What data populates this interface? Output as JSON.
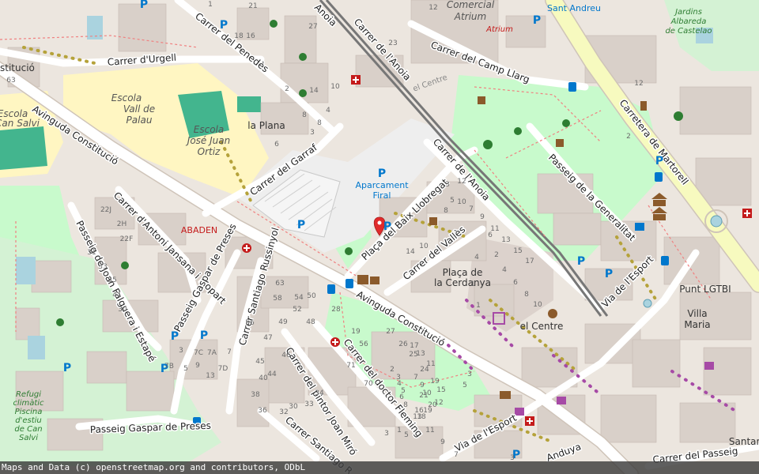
{
  "colors": {
    "background": "#ece6df",
    "building": "#d9d0c9",
    "park": "#c8facc",
    "school": "#fff6c2",
    "pitch": "#43b58e",
    "parking_area": "#eeeeee",
    "primary_road": "#f7fabf",
    "road": "#ffffff",
    "railway": "#777777",
    "marker": "#e02b2b",
    "parking_text": "#0077cc"
  },
  "streets": [
    {
      "text": "Carrer d'Urgell"
    },
    {
      "text": "Carrer del Penedès"
    },
    {
      "text": "Avinguda Constitució"
    },
    {
      "text": "Carrer del Garraf"
    },
    {
      "text": "Carrer d'Antoni Jansana i Llopart"
    },
    {
      "text": "Passeig de Joan Falguera i Estapé"
    },
    {
      "text": "Passeig Gaspar de Preses"
    },
    {
      "text": "Carrer Santiago Russinyol"
    },
    {
      "text": "Avinguda Constitució"
    },
    {
      "text": "Carrer del pintor Joan Miró"
    },
    {
      "text": "Carrer del doctor Fleming"
    },
    {
      "text": "Carrer Santiago R"
    },
    {
      "text": "Passeig Gaspar de Preses"
    },
    {
      "text": "Plaça del Baix Llobregat"
    },
    {
      "text": "Carrer del Vallès"
    },
    {
      "text": "Carrer de l'Anoia"
    },
    {
      "text": "Carrer de l'Anoia"
    },
    {
      "text": "Carrer del Camp Llarg"
    },
    {
      "text": "Carretera de Martorell"
    },
    {
      "text": "Passeig de la Generalitat"
    },
    {
      "text": "Via de l'Esport"
    },
    {
      "text": "Via de l'Esport"
    },
    {
      "text": "Carrer del Passeig"
    },
    {
      "text": "Anoia"
    },
    {
      "text": "Anduya"
    }
  ],
  "areas": [
    {
      "text": "Escola"
    },
    {
      "text": "Vall de"
    },
    {
      "text": "Palau"
    },
    {
      "text": "Escola"
    },
    {
      "text": "José Juan"
    },
    {
      "text": "Ortiz"
    },
    {
      "text": "Escola"
    },
    {
      "text": "Can Salvi"
    },
    {
      "text": "Aparcament"
    },
    {
      "text": "Firal"
    },
    {
      "text": "Comercial"
    },
    {
      "text": "Atrium"
    },
    {
      "text": "Jardins"
    },
    {
      "text": "Albareda"
    },
    {
      "text": "de Castelao"
    },
    {
      "text": "Refugi"
    },
    {
      "text": "climàtic"
    },
    {
      "text": "Piscina"
    },
    {
      "text": "d'estiu"
    },
    {
      "text": "de Can"
    },
    {
      "text": "Salvi"
    }
  ],
  "places": [
    {
      "text": "la Plana"
    },
    {
      "text": "el Centre"
    },
    {
      "text": "el Centre"
    },
    {
      "text": "Plaça de"
    },
    {
      "text": "la Cerdanya"
    },
    {
      "text": "Punt LGTBI"
    },
    {
      "text": "Villa"
    },
    {
      "text": "Maria"
    },
    {
      "text": "Sant Andreu"
    },
    {
      "text": "Santan"
    },
    {
      "text": "stitució"
    }
  ],
  "poi_labels": [
    {
      "text": "ABADEN"
    },
    {
      "text": "Atrium"
    }
  ],
  "parking_labels": [
    "P",
    "P",
    "P",
    "P",
    "P",
    "P",
    "P",
    "P",
    "P",
    "P",
    "P",
    "P",
    "P",
    "P"
  ],
  "house_numbers": [
    "12",
    "1",
    "21",
    "18",
    "16",
    "27",
    "10",
    "63",
    "23",
    "14",
    "4",
    "6",
    "8",
    "8",
    "2",
    "3",
    "2",
    "12",
    "22J",
    "2H",
    "22F",
    "31",
    "33",
    "41",
    "35",
    "30",
    "13",
    "7A",
    "5",
    "3",
    "7B",
    "7C",
    "7D",
    "7",
    "9",
    "63",
    "58",
    "56",
    "54",
    "52",
    "50",
    "49",
    "48",
    "47",
    "46",
    "45",
    "44",
    "40",
    "38",
    "36",
    "30",
    "32",
    "33",
    "34",
    "27",
    "26",
    "25",
    "24",
    "17",
    "19",
    "15",
    "21",
    "13",
    "11",
    "9",
    "7",
    "5",
    "1",
    "3",
    "14",
    "10",
    "10",
    "8",
    "12",
    "6",
    "4",
    "3",
    "5",
    "7",
    "9",
    "11",
    "13",
    "15",
    "17",
    "18",
    "16",
    "20",
    "19",
    "2",
    "3",
    "4",
    "5",
    "6",
    "8",
    "7",
    "9",
    "10",
    "12",
    "56",
    "71",
    "70",
    "28",
    "19",
    "13",
    "11",
    "3",
    "5",
    "3",
    "1",
    "1",
    "2",
    "4",
    "6",
    "8",
    "10"
  ],
  "icons": [
    "hospital-icon",
    "pharmacy-icon",
    "park-playground-icon",
    "library-icon",
    "bus-stop-icon",
    "dog-park-icon",
    "sport-running-icon",
    "fountain-icon",
    "theatre-icon",
    "shop-icon",
    "bicycle-icon",
    "fuel-station-icon",
    "toilet-icon",
    "atm-icon",
    "cafe-icon",
    "museum-icon"
  ],
  "marker": {
    "label": "map-pin-marker"
  },
  "attribution": "Maps and Data (c) openstreetmap.org and contributors, ODbL"
}
